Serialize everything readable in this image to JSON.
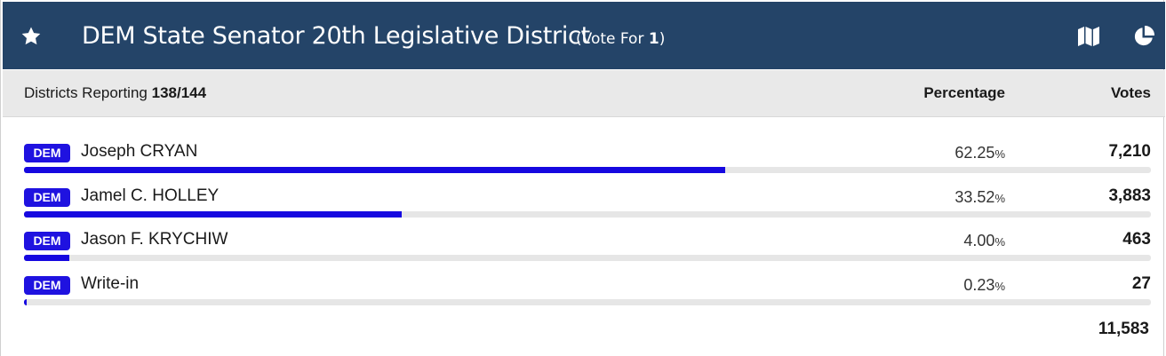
{
  "contest": {
    "title": "DEM State Senator 20th Legislative District",
    "vote_for_label": "(Vote For ",
    "vote_for_count": "1",
    "vote_for_close": ")"
  },
  "summary": {
    "reporting_label": "Districts Reporting ",
    "reporting_value": "138/144",
    "percentage_header": "Percentage",
    "votes_header": "Votes"
  },
  "candidates": [
    {
      "party": "DEM",
      "name": "Joseph CRYAN",
      "percent": "62.25",
      "percent_sign": "%",
      "votes": "7,210",
      "share": 0.6225
    },
    {
      "party": "DEM",
      "name": "Jamel C. HOLLEY",
      "percent": "33.52",
      "percent_sign": "%",
      "votes": "3,883",
      "share": 0.3352
    },
    {
      "party": "DEM",
      "name": "Jason F. KRYCHIW",
      "percent": "4.00",
      "percent_sign": "%",
      "votes": "463",
      "share": 0.04
    },
    {
      "party": "DEM",
      "name": "Write-in",
      "percent": "0.23",
      "percent_sign": "%",
      "votes": "27",
      "share": 0.0023
    }
  ],
  "total_votes": "11,583",
  "icons": {
    "favorite": "star-icon",
    "map": "map-icon",
    "chart": "pie-chart-icon"
  },
  "colors": {
    "header_bg": "#244468",
    "party_badge": "#1f12e0",
    "bar_fill": "#1608e0"
  }
}
